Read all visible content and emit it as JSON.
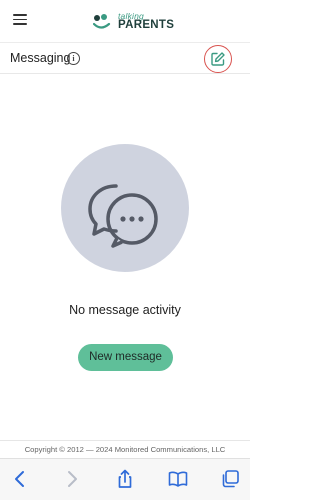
{
  "header": {
    "logo_top": "talking",
    "logo_bottom": "PARENTS",
    "menu_icon": "hamburger-menu-icon"
  },
  "subheader": {
    "title": "Messaging",
    "info_icon": "info-icon",
    "compose_icon": "compose-pencil-icon"
  },
  "empty_state": {
    "icon": "chat-bubbles-icon",
    "text": "No message activity",
    "button_label": "New message"
  },
  "footer": {
    "copyright": "Copyright © 2012 — 2024 Monitored Communications, LLC"
  },
  "browser_toolbar": {
    "icons": [
      "back-icon",
      "forward-icon",
      "share-icon",
      "bookmarks-icon",
      "tabs-icon"
    ]
  },
  "colors": {
    "accent_green": "#5fbf99",
    "brand_dark": "#1f3f3b",
    "highlight_red": "#d9534f",
    "empty_circle": "#cfd3df"
  }
}
